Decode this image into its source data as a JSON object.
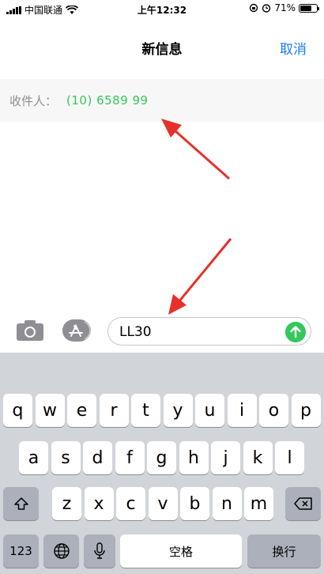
{
  "status_bar": {
    "carrier": "中国联通",
    "time": "上午12:32",
    "battery": "71%",
    "battery_level": 0.71
  },
  "nav": {
    "title": "新信息",
    "cancel_label": "取消"
  },
  "recipient": {
    "label": "收件人：",
    "value": "(10) 6589 99"
  },
  "compose": {
    "message_value": "LL30"
  },
  "keyboard": {
    "row1": [
      "q",
      "w",
      "e",
      "r",
      "t",
      "y",
      "u",
      "i",
      "o",
      "p"
    ],
    "row2": [
      "a",
      "s",
      "d",
      "f",
      "g",
      "h",
      "j",
      "k",
      "l"
    ],
    "row3": [
      "z",
      "x",
      "c",
      "v",
      "b",
      "n",
      "m"
    ],
    "numbers_label": "123",
    "space_label": "空格",
    "return_label": "换行"
  },
  "colors": {
    "accent_blue": "#1a7cf4",
    "green": "#34c759",
    "annotation_red": "#e8302a"
  }
}
